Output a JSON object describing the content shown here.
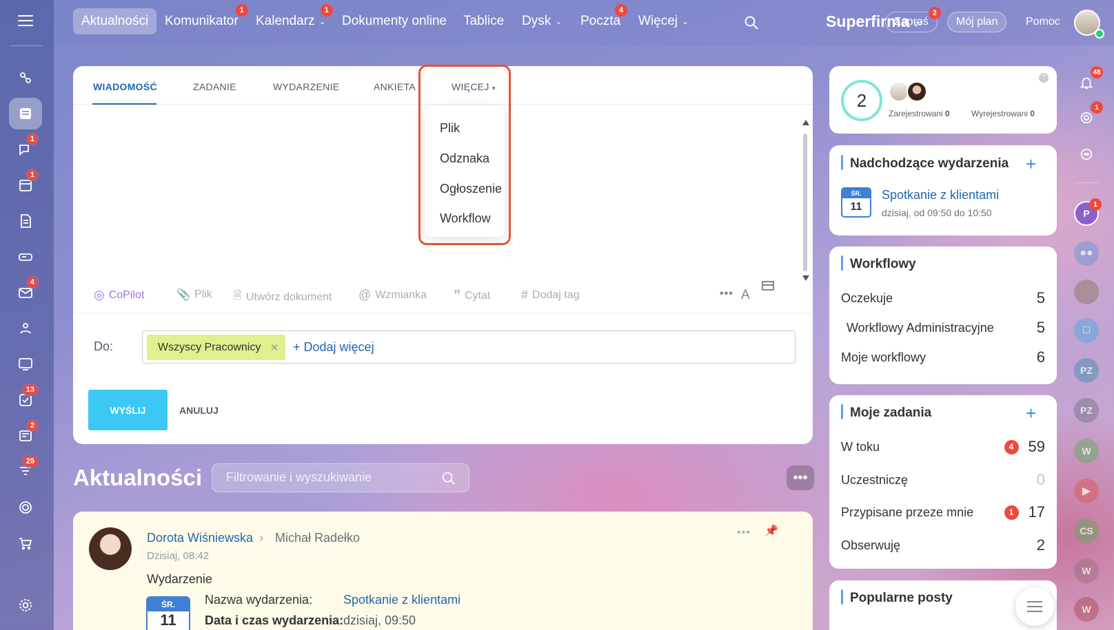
{
  "topnav": {
    "items": [
      {
        "label": "Aktualności"
      },
      {
        "label": "Komunikator",
        "badge": "1"
      },
      {
        "label": "Kalendarz",
        "badge": "1"
      },
      {
        "label": "Dokumenty online"
      },
      {
        "label": "Tablice"
      },
      {
        "label": "Dysk"
      },
      {
        "label": "Poczta",
        "badge": "4"
      },
      {
        "label": "Więcej"
      }
    ],
    "brand": "Superfirma",
    "invite": {
      "label": "Zaproś",
      "badge": "2"
    },
    "plan": "Mój plan",
    "help": "Pomoc"
  },
  "sidebar": {
    "badges": {
      "chat": "1",
      "calendar": "1",
      "mail": "4",
      "tasks": "13",
      "news": "2",
      "funnel": "25"
    }
  },
  "composer": {
    "tabs": [
      "WIADOMOŚĆ",
      "ZADANIE",
      "WYDARZENIE",
      "ANKIETA",
      "WIĘCEJ"
    ],
    "more_menu": [
      "Plik",
      "Odznaka",
      "Ogłoszenie",
      "Workflow"
    ],
    "toolbar": {
      "copilot": "CoPilot",
      "file": "Plik",
      "doc": "Utwórz dokument",
      "mention": "Wzmianka",
      "quote": "Cytat",
      "tag": "Dodaj tag"
    },
    "to_label": "Do:",
    "recipient": "Wszyscy Pracownicy",
    "add_more": "+ Dodaj więcej",
    "send": "WYŚLIJ",
    "cancel": "ANULUJ"
  },
  "feed": {
    "title": "Aktualności",
    "search_placeholder": "Filtrowanie i wyszukiwanie"
  },
  "post": {
    "author": "Dorota Wiśniewska",
    "recipient": "Michał Radełko",
    "time": "Dzisiaj, 08:42",
    "type": "Wydarzenie",
    "cal_day_name": "ŚR.",
    "cal_day": "11",
    "event_name_label": "Nazwa wydarzenia:",
    "event_name": "Spotkanie z klientami",
    "event_time_label": "Data i czas wydarzenia:",
    "event_time": "dzisiaj, 09:50"
  },
  "right": {
    "attendance": {
      "count": "2",
      "registered_label": "Zarejestrowani",
      "registered": "0",
      "unregistered_label": "Wyrejestrowani",
      "unregistered": "0"
    },
    "events": {
      "title": "Nadchodzące wydarzenia",
      "day_name": "ŚR.",
      "day": "11",
      "name": "Spotkanie z klientami",
      "time": "dzisiaj, od 09:50 do 10:50"
    },
    "workflows": {
      "title": "Workflowy",
      "rows": [
        {
          "label": "Oczekuje",
          "value": "5"
        },
        {
          "label": "Workflowy Administracyjne",
          "value": "5"
        },
        {
          "label": "Moje workflowy",
          "value": "6"
        }
      ]
    },
    "tasks": {
      "title": "Moje zadania",
      "rows": [
        {
          "label": "W toku",
          "value": "59",
          "badge": "4"
        },
        {
          "label": "Uczestniczę",
          "value": "0"
        },
        {
          "label": "Przypisane przeze mnie",
          "value": "17",
          "badge": "1"
        },
        {
          "label": "Obserwuję",
          "value": "2"
        }
      ]
    },
    "popular": {
      "title": "Popularne posty"
    }
  },
  "rail": {
    "notifications_badge": "48",
    "second_badge": "1",
    "p_badge": "1",
    "avatars": [
      "P",
      "PZ",
      "PZ",
      "W",
      "CS",
      "W",
      "W"
    ]
  },
  "colors": {
    "accent": "#2067b0",
    "send": "#3bc8f5",
    "badge": "#f0483e",
    "highlight": "#e5542e",
    "chip": "#dff08e"
  }
}
